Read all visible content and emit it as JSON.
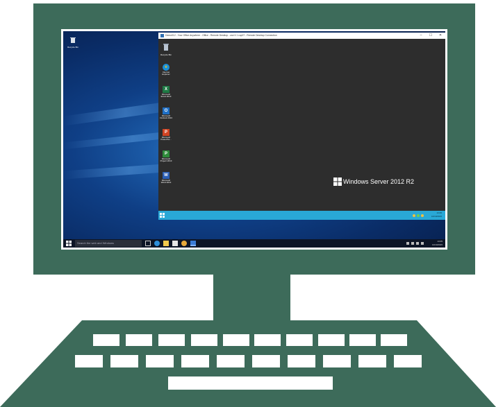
{
  "host": {
    "recycle_bin_label": "Recycle Bin",
    "search_placeholder": "Search the web and Windows",
    "clock_time": "13:05",
    "clock_date": "10/10/2015"
  },
  "rdp": {
    "title": "Demo012 - Your Office Anywhere - Office - Remote Desktop - use it 1 cup07 - Remote Desktop Connection",
    "minimize": "–",
    "maximize": "☐",
    "close": "✕",
    "server_brand": "Windows Server 2012 R2",
    "icons": [
      {
        "label": "Recycle Bin"
      },
      {
        "label": "Internet Explorer"
      },
      {
        "label": "Microsoft Excel 2013"
      },
      {
        "label": "Microsoft Outlook 2013"
      },
      {
        "label": "Microsoft PowerPoi..."
      },
      {
        "label": "Microsoft Project 2013"
      },
      {
        "label": "Microsoft Word 2013"
      }
    ],
    "clock_time": "13:05",
    "clock_date": "10/10/2015"
  },
  "colors": {
    "frame": "#3d6b5a",
    "server_taskbar": "#29a8d6",
    "rdp_background": "#2d2d2d"
  }
}
